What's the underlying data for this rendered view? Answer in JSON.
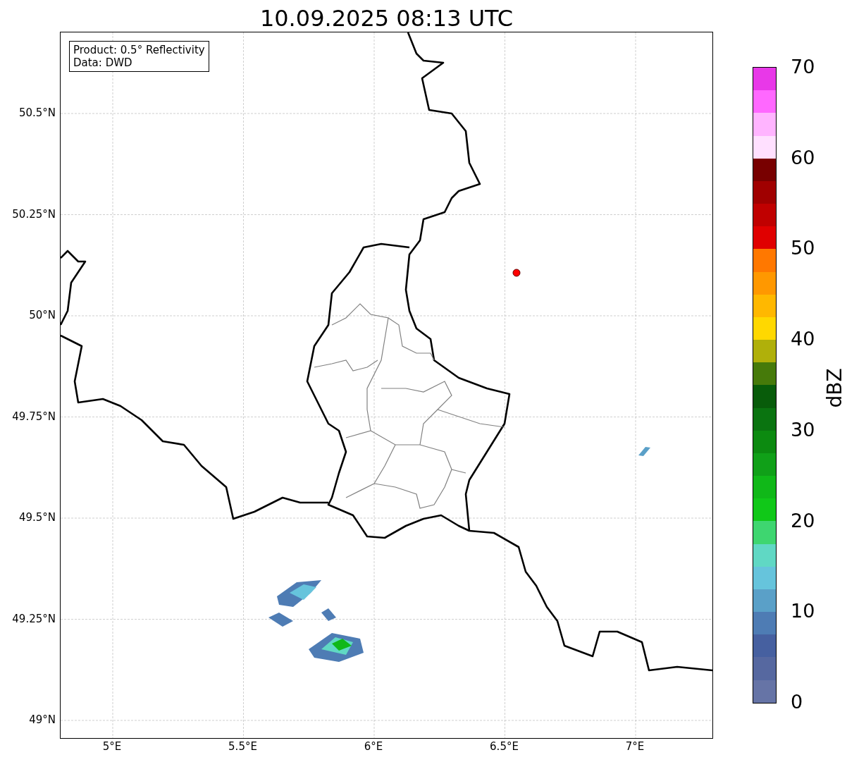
{
  "title": "10.09.2025 08:13 UTC",
  "map": {
    "legend": [
      "Product: 0.5° Reflectivity",
      "Data: DWD"
    ],
    "lat_ticks": [
      "50.5°N",
      "50.25°N",
      "50°N",
      "49.75°N",
      "49.5°N",
      "49.25°N",
      "49°N"
    ],
    "lon_ticks": [
      "5°E",
      "5.5°E",
      "6°E",
      "6.5°E",
      "7°E"
    ]
  },
  "colorbar": {
    "label": "dBZ",
    "ticks": [
      "70",
      "60",
      "50",
      "40",
      "30",
      "20",
      "10",
      "0"
    ],
    "segments": [
      {
        "color": "#e838e8"
      },
      {
        "color": "#ff68ff"
      },
      {
        "color": "#ffb4ff"
      },
      {
        "color": "#ffe0ff"
      },
      {
        "color": "#780000"
      },
      {
        "color": "#a00000"
      },
      {
        "color": "#c00000"
      },
      {
        "color": "#e00000"
      },
      {
        "color": "#ff7800"
      },
      {
        "color": "#ff9800"
      },
      {
        "color": "#ffb800"
      },
      {
        "color": "#ffd800"
      },
      {
        "color": "#b0b00a"
      },
      {
        "color": "#467a0a"
      },
      {
        "color": "#085c0a"
      },
      {
        "color": "#0a7410"
      },
      {
        "color": "#0c8a10"
      },
      {
        "color": "#10a018"
      },
      {
        "color": "#10b818"
      },
      {
        "color": "#10c818"
      },
      {
        "color": "#3ed670"
      },
      {
        "color": "#60d8c4"
      },
      {
        "color": "#66c4dc"
      },
      {
        "color": "#5aa0c8"
      },
      {
        "color": "#4e7cb4"
      },
      {
        "color": "#4660a0"
      },
      {
        "color": "#5668a0"
      },
      {
        "color": "#6674a6"
      }
    ]
  }
}
